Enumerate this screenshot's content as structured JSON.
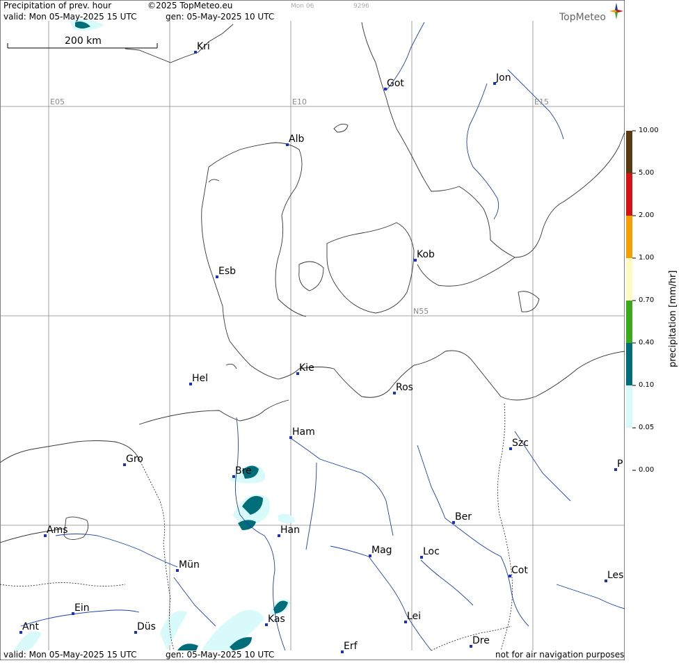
{
  "header": {
    "title": "Precipitation of prev. hour",
    "copyright": "©2025 TopMeteo.eu",
    "valid": "valid:  Mon  05-May-2025  15 UTC",
    "generated": "gen: 05-May-2025 10 UTC",
    "faint_day": "Mon 06",
    "faint_code": "9296",
    "brand": "TopMeteo"
  },
  "footer": {
    "valid": "valid:  Mon  05-May-2025  15 UTC",
    "generated": "gen: 05-May-2025 10 UTC",
    "disclaimer": "not for air navigation purposes"
  },
  "scale_bar": {
    "label": "200 km"
  },
  "grid_labels": [
    "E05",
    "E10",
    "E15",
    "N55"
  ],
  "cities": [
    "Kri",
    "Got",
    "Jon",
    "Alb",
    "Kob",
    "Esb",
    "Kie",
    "Hel",
    "Ros",
    "Ham",
    "Szc",
    "Gro",
    "Bre",
    "P",
    "Ams",
    "Han",
    "Ber",
    "Mag",
    "Loc",
    "Mün",
    "Cot",
    "Les",
    "Ein",
    "Kas",
    "Lei",
    "Ant",
    "Düs",
    "Dre",
    "Erf"
  ],
  "legend": {
    "title": "precipitation [mm/hr]",
    "ticks": [
      "10.00",
      "5.00",
      "2.00",
      "1.00",
      "0.70",
      "0.40",
      "0.10",
      "0.05",
      "0.00"
    ],
    "colors": [
      "#5a3a10",
      "#d41212",
      "#f5a000",
      "#fffac0",
      "#3aaa1a",
      "#006e78",
      "#d8fafa"
    ]
  }
}
